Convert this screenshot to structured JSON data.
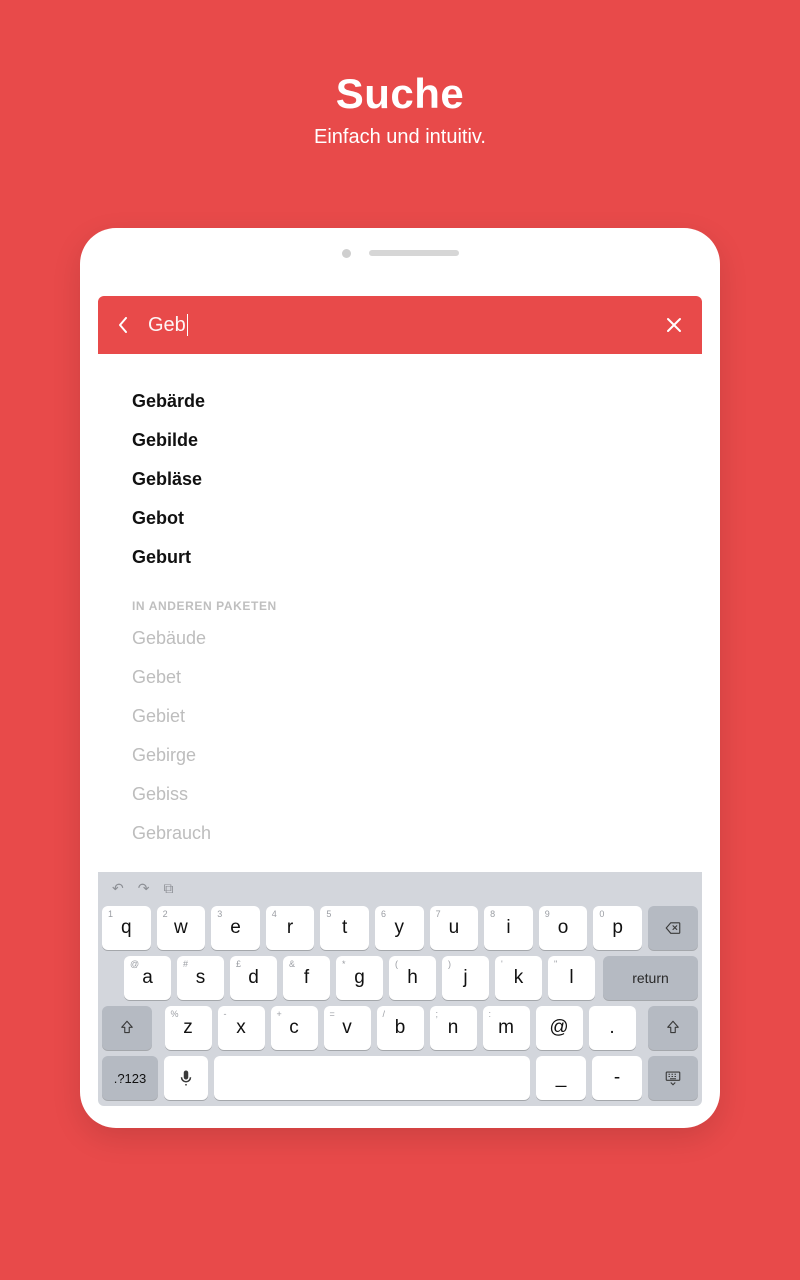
{
  "promo": {
    "title": "Suche",
    "subtitle": "Einfach und intuitiv."
  },
  "search": {
    "query": "Geb"
  },
  "results": {
    "primary": [
      "Gebärde",
      "Gebilde",
      "Gebläse",
      "Gebot",
      "Geburt"
    ],
    "other_label": "IN ANDEREN PAKETEN",
    "other": [
      "Gebäude",
      "Gebet",
      "Gebiet",
      "Gebirge",
      "Gebiss",
      "Gebrauch"
    ]
  },
  "keyboard": {
    "row1": [
      {
        "main": "q",
        "alt": "1"
      },
      {
        "main": "w",
        "alt": "2"
      },
      {
        "main": "e",
        "alt": "3"
      },
      {
        "main": "r",
        "alt": "4"
      },
      {
        "main": "t",
        "alt": "5"
      },
      {
        "main": "y",
        "alt": "6"
      },
      {
        "main": "u",
        "alt": "7"
      },
      {
        "main": "i",
        "alt": "8"
      },
      {
        "main": "o",
        "alt": "9"
      },
      {
        "main": "p",
        "alt": "0"
      }
    ],
    "row2": [
      {
        "main": "a",
        "alt": "@"
      },
      {
        "main": "s",
        "alt": "#"
      },
      {
        "main": "d",
        "alt": "£"
      },
      {
        "main": "f",
        "alt": "&"
      },
      {
        "main": "g",
        "alt": "*"
      },
      {
        "main": "h",
        "alt": "("
      },
      {
        "main": "j",
        "alt": ")"
      },
      {
        "main": "k",
        "alt": "'"
      },
      {
        "main": "l",
        "alt": "\""
      }
    ],
    "return_label": "return",
    "row3": [
      {
        "main": "z",
        "alt": "%"
      },
      {
        "main": "x",
        "alt": "-"
      },
      {
        "main": "c",
        "alt": "+"
      },
      {
        "main": "v",
        "alt": "="
      },
      {
        "main": "b",
        "alt": "/"
      },
      {
        "main": "n",
        "alt": ";"
      },
      {
        "main": "m",
        "alt": ":"
      },
      {
        "main": "@",
        "alt": ""
      },
      {
        "main": ".",
        "alt": ""
      }
    ],
    "numeric_label": ".?123",
    "underscore": "_",
    "dash": "-"
  }
}
